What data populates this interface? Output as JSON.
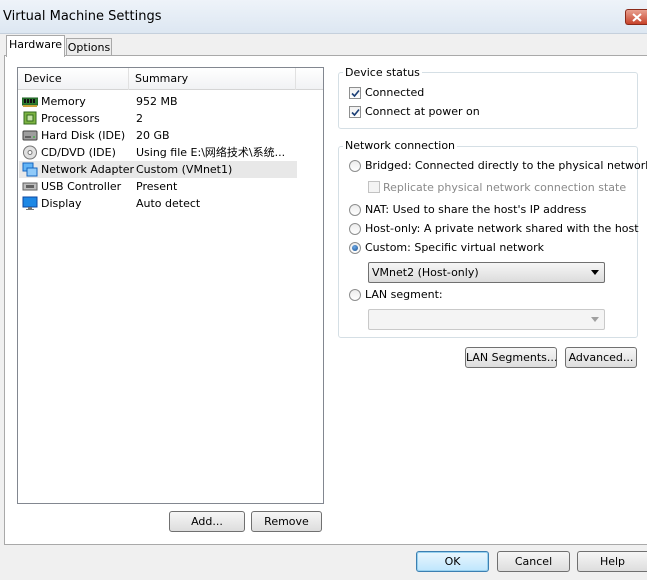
{
  "window": {
    "title": "Virtual Machine Settings"
  },
  "tabs": [
    {
      "label": "Hardware",
      "active": true
    },
    {
      "label": "Options",
      "active": false
    }
  ],
  "device_list": {
    "columns": [
      "Device",
      "Summary"
    ],
    "rows": [
      {
        "device": "Memory",
        "summary": "952 MB",
        "icon": "memory-icon"
      },
      {
        "device": "Processors",
        "summary": "2",
        "icon": "processor-icon"
      },
      {
        "device": "Hard Disk (IDE)",
        "summary": "20 GB",
        "icon": "hard-disk-icon"
      },
      {
        "device": "CD/DVD (IDE)",
        "summary": "Using file E:\\网络技术\\系统...",
        "icon": "cd-dvd-icon"
      },
      {
        "device": "Network Adapter",
        "summary": "Custom (VMnet1)",
        "icon": "network-adapter-icon",
        "selected": true
      },
      {
        "device": "USB Controller",
        "summary": "Present",
        "icon": "usb-icon"
      },
      {
        "device": "Display",
        "summary": "Auto detect",
        "icon": "display-icon"
      }
    ],
    "add_label": "Add...",
    "remove_label": "Remove"
  },
  "device_status": {
    "title": "Device status",
    "connected_label": "Connected",
    "connected": true,
    "connect_power_label": "Connect at power on",
    "connect_power": true
  },
  "network_connection": {
    "title": "Network connection",
    "bridged_label": "Bridged: Connected directly to the physical network",
    "replicate_label": "Replicate physical network connection state",
    "nat_label": "NAT: Used to share the host's IP address",
    "hostonly_label": "Host-only: A private network shared with the host",
    "custom_label": "Custom: Specific virtual network",
    "custom_value": "VMnet2 (Host-only)",
    "lan_label": "LAN segment:",
    "lan_value": "",
    "selected": "custom"
  },
  "panel_buttons": {
    "lan_segments_label": "LAN Segments...",
    "advanced_label": "Advanced..."
  },
  "footer": {
    "ok_label": "OK",
    "cancel_label": "Cancel",
    "help_label": "Help"
  },
  "colors": {
    "accent": "#3c7fb1",
    "selection": "#e8e8e8"
  }
}
